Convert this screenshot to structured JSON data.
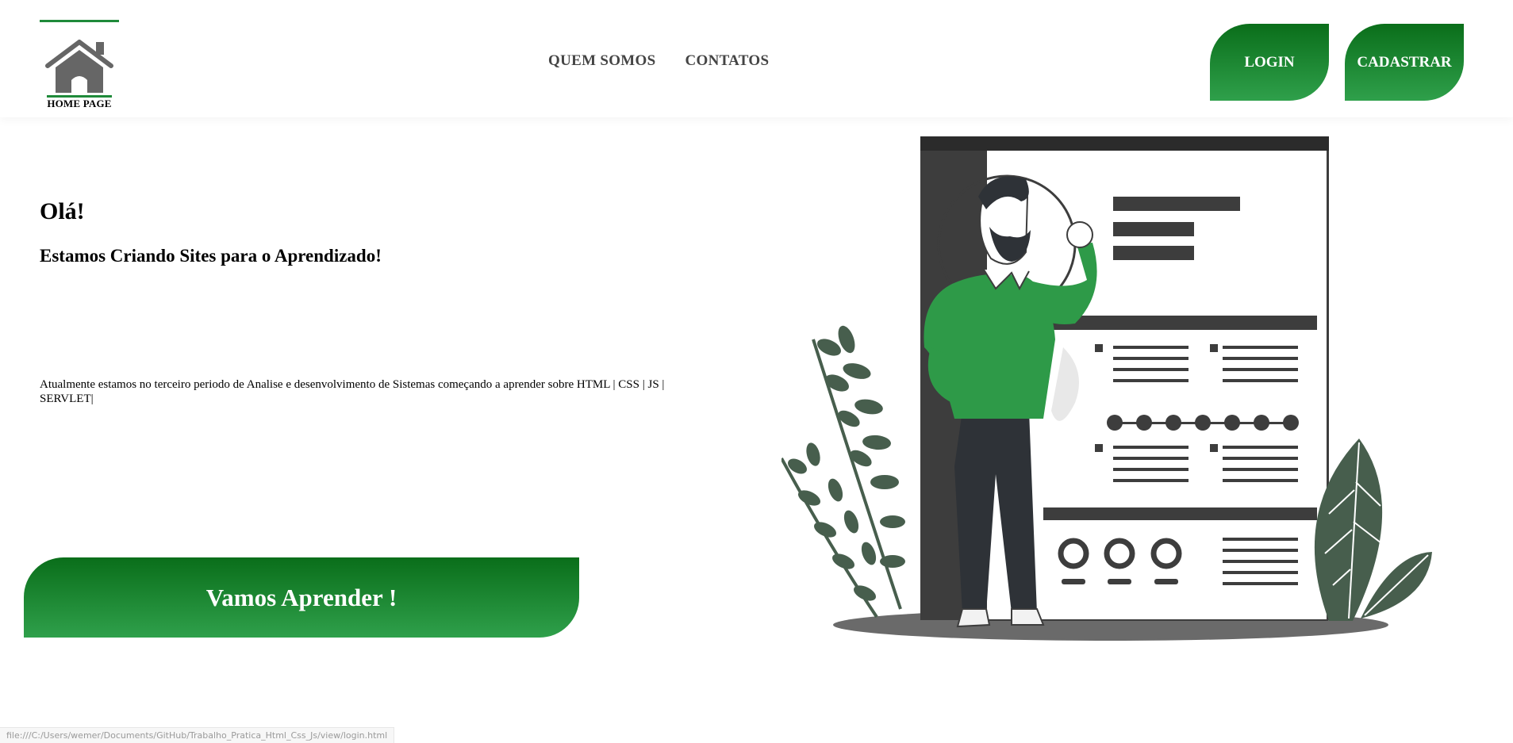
{
  "header": {
    "logo_label": "HOME PAGE",
    "logo_icon": "house-icon",
    "nav": [
      {
        "label": "QUEM SOMOS"
      },
      {
        "label": "CONTATOS"
      }
    ],
    "login_label": "LOGIN",
    "signup_label": "CADASTRAR"
  },
  "hero": {
    "title": "Olá!",
    "subtitle": "Estamos Criando Sites para o Aprendizado!",
    "text": "Atualmente estamos no terceiro periodo de Analise e desenvolvimento de Sistemas começando a aprender sobre HTML | CSS | JS | SERVLET|",
    "cta_label": "Vamos Aprender !",
    "illustration": "resume-person-illustration"
  },
  "status_bar": {
    "url": "file:///C:/Users/wemer/Documents/GitHub/Trabalho_Pratica_Html_Css_Js/view/login.html"
  },
  "colors": {
    "brand_green_dark": "#0a6e1a",
    "brand_green_light": "#2fa04b",
    "illustration_green": "#2e9a48",
    "illustration_dark": "#3a3a3a"
  }
}
